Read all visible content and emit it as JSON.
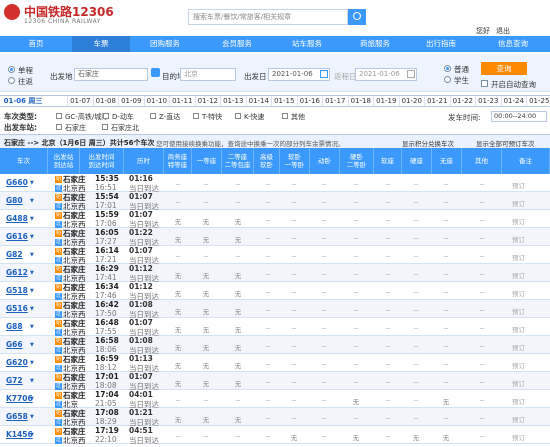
{
  "header": {
    "logo_title": "中国铁路12306",
    "logo_subtitle": "12306 CHINA RAILWAY",
    "search_placeholder": "搜索车票/餐饮/常旅客/相关规章",
    "user": [
      "您好",
      "退出"
    ]
  },
  "nav": [
    "首页",
    "车票",
    "团购服务",
    "会员服务",
    "站车服务",
    "商旅服务",
    "出行指南",
    "信息查询"
  ],
  "query": {
    "trip_types": [
      "单程",
      "往返"
    ],
    "from_label": "出发地",
    "from_value": "石家庄",
    "to_label": "目的地",
    "to_value": "北京",
    "depart_label": "出发日",
    "depart_value": "2021-01-06",
    "return_label": "返程日",
    "return_value": "2021-01-06",
    "passenger_types": [
      "普通",
      "学生"
    ],
    "query_button": "查询",
    "auto_query_label": "开启自动查询"
  },
  "dates": {
    "current": "01-06 周三",
    "items": [
      "01-07",
      "01-08",
      "01-09",
      "01-10",
      "01-11",
      "01-12",
      "01-13",
      "01-14",
      "01-15",
      "01-16",
      "01-17",
      "01-18",
      "01-19",
      "01-20",
      "01-21",
      "01-22",
      "01-23",
      "01-24",
      "01-25"
    ]
  },
  "filters": {
    "train_type_label": "车次类型:",
    "train_types": [
      "GC-高铁/城际",
      "D-动车",
      "Z-直达",
      "T-特快",
      "K-快速",
      "其他"
    ],
    "depart_station_label": "出发车站:",
    "depart_stations": [
      "石家庄",
      "石家庄北"
    ],
    "depart_time_label": "发车时间:",
    "depart_time_value": "00:00--24:00"
  },
  "summary": {
    "route": "石家庄 --> 北京（1月6日 周三）共计56个车次",
    "notice": "您可使用接续换乘功能，查询途中换乘一次的部分列车余票情况。",
    "right_options": [
      "显示积分兑换车次",
      "显示全部可预订车次"
    ]
  },
  "table": {
    "headers": [
      "车次",
      "出发站\n到达站",
      "出发时间\n到达时间",
      "历时",
      "商务座\n特等座",
      "一等座",
      "二等座\n二等包座",
      "高级\n软卧",
      "软卧\n一等卧",
      "动卧",
      "硬卧\n二等卧",
      "软座",
      "硬座",
      "无座",
      "其他",
      "备注"
    ],
    "rows": [
      {
        "train": "G660",
        "from": "石家庄",
        "to": "北京西",
        "dep": "15:35",
        "arr": "16:51",
        "dur": "01:16",
        "day": "当日到达",
        "seats": [
          "--",
          "--",
          "--",
          "--",
          "--",
          "--",
          "--",
          "--",
          "--",
          "--",
          "--"
        ],
        "book": "预订"
      },
      {
        "train": "G80",
        "from": "石家庄",
        "to": "北京西",
        "dep": "15:54",
        "arr": "17:01",
        "dur": "01:07",
        "day": "当日到达",
        "seats": [
          "--",
          "--",
          "--",
          "--",
          "--",
          "--",
          "--",
          "--",
          "--",
          "--",
          "--"
        ],
        "book": "预订"
      },
      {
        "train": "G488",
        "from": "石家庄",
        "to": "北京西",
        "dep": "15:59",
        "arr": "17:06",
        "dur": "01:07",
        "day": "当日到达",
        "seats": [
          "无",
          "无",
          "无",
          "--",
          "--",
          "--",
          "--",
          "--",
          "--",
          "--",
          "--"
        ],
        "book": "预订"
      },
      {
        "train": "G616",
        "from": "石家庄",
        "to": "北京西",
        "dep": "16:05",
        "arr": "17:27",
        "dur": "01:22",
        "day": "当日到达",
        "seats": [
          "无",
          "无",
          "无",
          "--",
          "--",
          "--",
          "--",
          "--",
          "--",
          "--",
          "--"
        ],
        "book": "预订"
      },
      {
        "train": "G82",
        "from": "石家庄",
        "to": "北京西",
        "dep": "16:14",
        "arr": "17:21",
        "dur": "01:07",
        "day": "当日到达",
        "seats": [
          "--",
          "--",
          "--",
          "--",
          "--",
          "--",
          "--",
          "--",
          "--",
          "--",
          "--"
        ],
        "book": "预订"
      },
      {
        "train": "G612",
        "from": "石家庄",
        "to": "北京西",
        "dep": "16:29",
        "arr": "17:41",
        "dur": "01:12",
        "day": "当日到达",
        "seats": [
          "无",
          "无",
          "无",
          "--",
          "--",
          "--",
          "--",
          "--",
          "--",
          "--",
          "--"
        ],
        "book": "预订"
      },
      {
        "train": "G518",
        "from": "石家庄",
        "to": "北京西",
        "dep": "16:34",
        "arr": "17:46",
        "dur": "01:12",
        "day": "当日到达",
        "seats": [
          "无",
          "无",
          "无",
          "--",
          "--",
          "--",
          "--",
          "--",
          "--",
          "--",
          "--"
        ],
        "book": "预订"
      },
      {
        "train": "G516",
        "from": "石家庄",
        "to": "北京西",
        "dep": "16:42",
        "arr": "17:50",
        "dur": "01:08",
        "day": "当日到达",
        "seats": [
          "无",
          "无",
          "无",
          "--",
          "--",
          "--",
          "--",
          "--",
          "--",
          "--",
          "--"
        ],
        "book": "预订"
      },
      {
        "train": "G88",
        "from": "石家庄",
        "to": "北京西",
        "dep": "16:48",
        "arr": "17:55",
        "dur": "01:07",
        "day": "当日到达",
        "seats": [
          "无",
          "无",
          "无",
          "--",
          "--",
          "--",
          "--",
          "--",
          "--",
          "--",
          "--"
        ],
        "book": "预订"
      },
      {
        "train": "G66",
        "from": "石家庄",
        "to": "北京西",
        "dep": "16:58",
        "arr": "18:06",
        "dur": "01:08",
        "day": "当日到达",
        "seats": [
          "无",
          "无",
          "无",
          "--",
          "--",
          "--",
          "--",
          "--",
          "--",
          "--",
          "--"
        ],
        "book": "预订"
      },
      {
        "train": "G620",
        "from": "石家庄",
        "to": "北京西",
        "dep": "16:59",
        "arr": "18:12",
        "dur": "01:13",
        "day": "当日到达",
        "seats": [
          "无",
          "无",
          "无",
          "--",
          "--",
          "--",
          "--",
          "--",
          "--",
          "--",
          "--"
        ],
        "book": "预订"
      },
      {
        "train": "G72",
        "from": "石家庄",
        "to": "北京西",
        "dep": "17:01",
        "arr": "18:08",
        "dur": "01:07",
        "day": "当日到达",
        "seats": [
          "无",
          "无",
          "无",
          "--",
          "--",
          "--",
          "--",
          "--",
          "--",
          "--",
          "--"
        ],
        "book": "预订"
      },
      {
        "train": "K7706",
        "from": "石家庄",
        "to": "北京",
        "dep": "17:04",
        "arr": "21:05",
        "dur": "04:01",
        "day": "当日到达",
        "seats": [
          "--",
          "--",
          "--",
          "--",
          "--",
          "--",
          "无",
          "--",
          "--",
          "无",
          "--"
        ],
        "book": "预订"
      },
      {
        "train": "G658",
        "from": "石家庄",
        "to": "北京西",
        "dep": "17:08",
        "arr": "18:29",
        "dur": "01:21",
        "day": "当日到达",
        "seats": [
          "无",
          "无",
          "无",
          "--",
          "--",
          "--",
          "--",
          "--",
          "--",
          "--",
          "--"
        ],
        "book": "预订"
      },
      {
        "train": "K1456",
        "from": "石家庄",
        "to": "北京西",
        "dep": "17:19",
        "arr": "22:10",
        "dur": "04:51",
        "day": "当日到达",
        "seats": [
          "--",
          "--",
          "--",
          "--",
          "无",
          "--",
          "无",
          "--",
          "无",
          "无",
          "--"
        ],
        "book": "预订"
      }
    ]
  }
}
